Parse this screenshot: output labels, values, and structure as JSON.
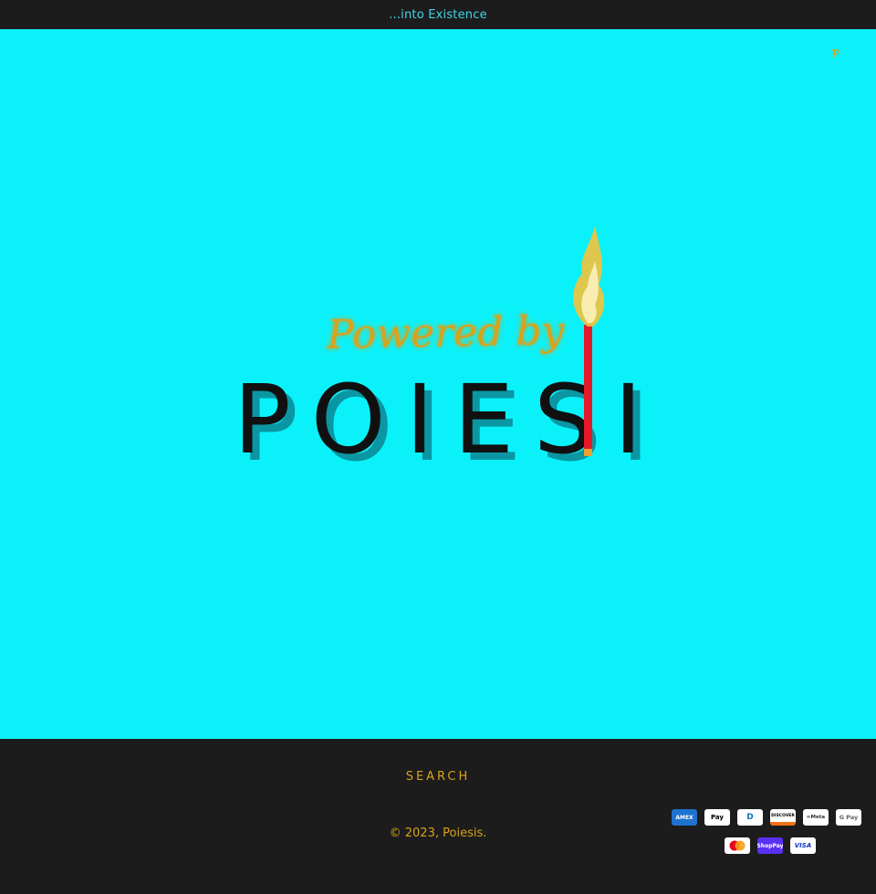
{
  "announcement": {
    "text": "...into Existence"
  },
  "header": {
    "icon": "lock-icon",
    "icon_glyph": "Ƥ"
  },
  "hero": {
    "logo": {
      "tagline": "Powered by",
      "brand": "POIESIS",
      "tagline_color": "#d8a21a",
      "brand_color": "#101010",
      "shadow_color": "#0a8d99",
      "match_stick_color": "#e5192a",
      "flame_color": "#f4c23a"
    },
    "background": "#0bf1fa"
  },
  "footer": {
    "search_label": "SEARCH",
    "copyright_prefix": "© 2023,",
    "copyright_brand": "Poiesis",
    "copyright_suffix": ".",
    "payment_methods": [
      {
        "name": "American Express",
        "label": "AMEX",
        "icon": "amex-icon"
      },
      {
        "name": "Apple Pay",
        "label": " Pay",
        "icon": "apple-pay-icon"
      },
      {
        "name": "Diners Club",
        "label": "D",
        "icon": "diners-club-icon"
      },
      {
        "name": "Discover",
        "label": "DISCOVER",
        "icon": "discover-icon"
      },
      {
        "name": "Meta Pay",
        "label": "∞Meta",
        "icon": "meta-pay-icon"
      },
      {
        "name": "Google Pay",
        "label": "G Pay",
        "icon": "google-pay-icon"
      },
      {
        "name": "Mastercard",
        "label": "",
        "icon": "mastercard-icon"
      },
      {
        "name": "Shop Pay",
        "label": "ShopPay",
        "icon": "shop-pay-icon"
      },
      {
        "name": "Visa",
        "label": "VISA",
        "icon": "visa-icon"
      }
    ]
  }
}
